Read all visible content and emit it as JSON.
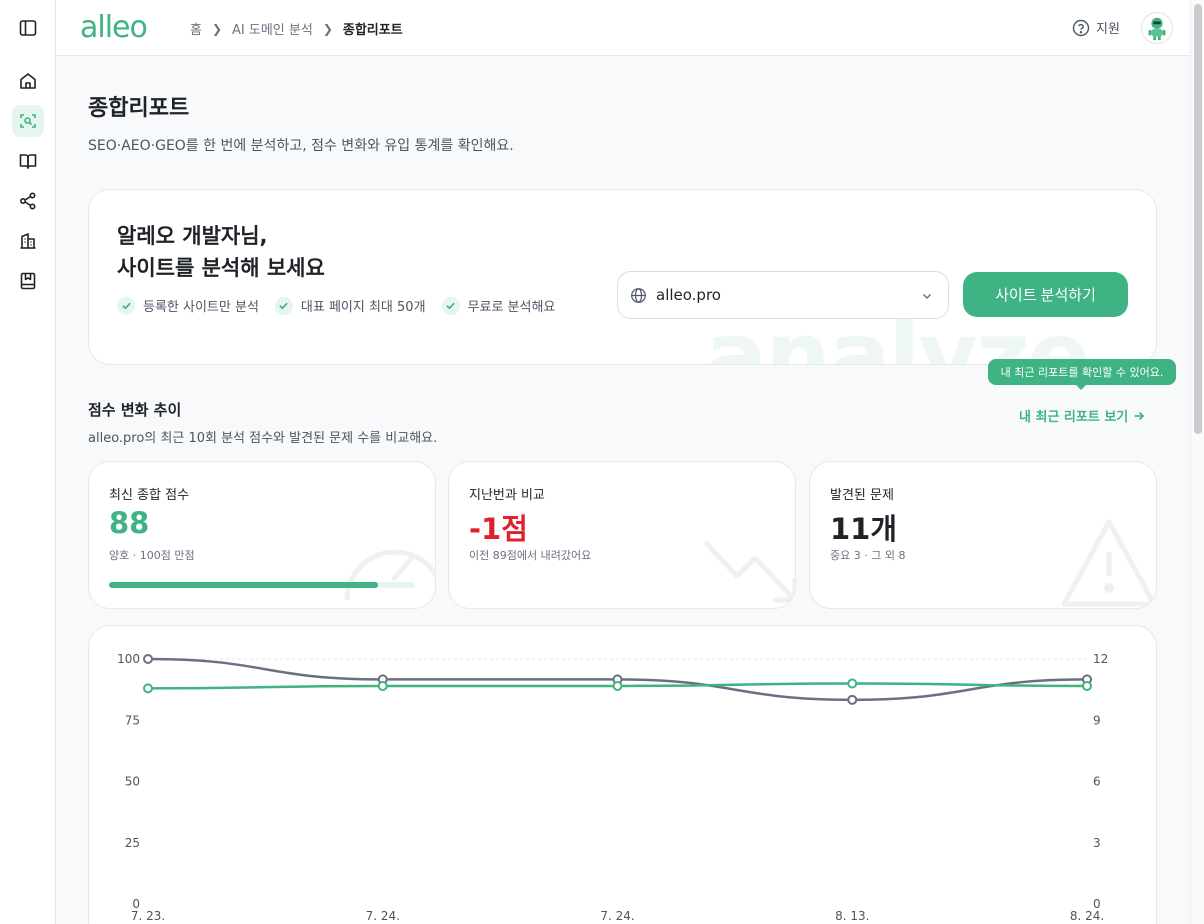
{
  "app": {
    "logo": "alleo"
  },
  "breadcrumb": {
    "home": "홈",
    "middle": "AI 도메인 분석",
    "current": "종합리포트"
  },
  "header": {
    "support_label": "지원"
  },
  "sidebar": {
    "items": [
      "sidebar-toggle",
      "home",
      "domain-analysis",
      "guide",
      "share",
      "buildings",
      "bookmark"
    ]
  },
  "page": {
    "title": "종합리포트",
    "subtitle": "SEO·AEO·GEO를 한 번에 분석하고, 점수 변화와 유입 통계를 확인해요."
  },
  "analyze": {
    "title_line1": "알레오 개발자님,",
    "title_line2": "사이트를 분석해 보세요",
    "checks": [
      "등록한 사이트만 분석",
      "대표 페이지 최대 50개",
      "무료로 분석해요"
    ],
    "watermark": "analyze",
    "site_value": "alleo.pro",
    "button_label": "사이트 분석하기"
  },
  "tooltip": "내 최근 리포트를 확인할 수 있어요.",
  "score_section": {
    "title": "점수 변화 추이",
    "subtitle": "alleo.pro의 최근 10회 분석 점수와 발견된 문제 수를 비교해요.",
    "recent_link": "내 최근 리포트 보기"
  },
  "stats": {
    "latest": {
      "label": "최신 종합 점수",
      "value": "88",
      "note": "양호 · 100점 만점",
      "progress": 0.88,
      "color": "#3fb384"
    },
    "compare": {
      "label": "지난번과 비교",
      "value": "-1점",
      "note": "이전 89점에서 내려갔어요",
      "color": "#e0202c"
    },
    "issues": {
      "label": "발견된 문제",
      "value": "11개",
      "note": "중요 3 · 그 외 8",
      "color": "#1f2328"
    }
  },
  "chart_data": {
    "type": "line",
    "categories": [
      "7. 23.",
      "7. 24.",
      "7. 24.",
      "8. 13.",
      "8. 24."
    ],
    "series": [
      {
        "values": [
          88,
          89,
          89,
          90,
          89
        ],
        "axis": "left",
        "color": "#3fb384"
      },
      {
        "values": [
          12,
          11,
          11,
          10,
          11
        ],
        "axis": "right",
        "color": "#6b7080"
      }
    ],
    "ylim_left": [
      0,
      100
    ],
    "yticks_left": [
      0,
      25,
      50,
      75,
      100
    ],
    "ylim_right": [
      0,
      12
    ],
    "yticks_right": [
      0,
      3,
      6,
      9,
      12
    ],
    "grid": "dashed top line"
  }
}
